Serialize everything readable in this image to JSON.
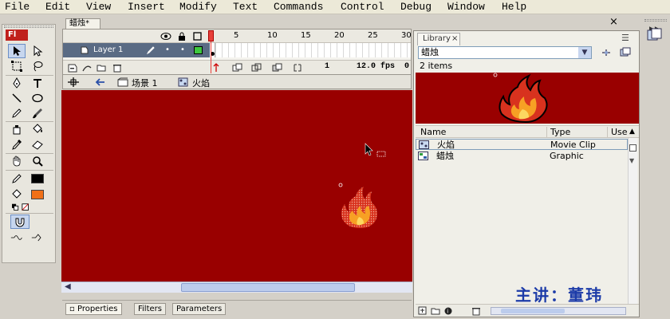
{
  "menu": {
    "items": [
      {
        "label": "File"
      },
      {
        "label": "Edit"
      },
      {
        "label": "View"
      },
      {
        "label": "Insert"
      },
      {
        "label": "Modify"
      },
      {
        "label": "Text"
      },
      {
        "label": "Commands"
      },
      {
        "label": "Control"
      },
      {
        "label": "Debug"
      },
      {
        "label": "Window"
      },
      {
        "label": "Help"
      }
    ]
  },
  "tools": {
    "logo": "Fl"
  },
  "document": {
    "tab_label": "蜡烛*",
    "close_glyph": "×"
  },
  "timeline": {
    "frame_numbers": [
      "1",
      "5",
      "10",
      "15",
      "20",
      "25",
      "30"
    ],
    "layer_name": "Layer 1",
    "current_frame": "1",
    "frame_rate": "12.0 fps",
    "extra_value": "0"
  },
  "editbar": {
    "scene_label": "场景 1",
    "symbol_label": "火焰"
  },
  "library": {
    "tab_label": "Library",
    "close_glyph": "×",
    "selected_document": "蜡烛",
    "item_count": "2 items",
    "columns": {
      "name": "Name",
      "type": "Type",
      "use": "Use"
    },
    "items": [
      {
        "name": "火焰",
        "type": "Movie Clip"
      },
      {
        "name": "蜡烛",
        "type": "Graphic"
      }
    ]
  },
  "properties": {
    "tabs": [
      {
        "label": "Properties"
      },
      {
        "label": "Filters"
      },
      {
        "label": "Parameters"
      }
    ]
  },
  "watermark": {
    "text": "主讲：董玮"
  },
  "colors": {
    "stage": "#990000",
    "flame_outer": "#d8321e",
    "flame_inner": "#f7a024",
    "fill_swatch": "#f07018",
    "stroke_swatch": "#000000",
    "watermark": "#1c3ba8"
  }
}
